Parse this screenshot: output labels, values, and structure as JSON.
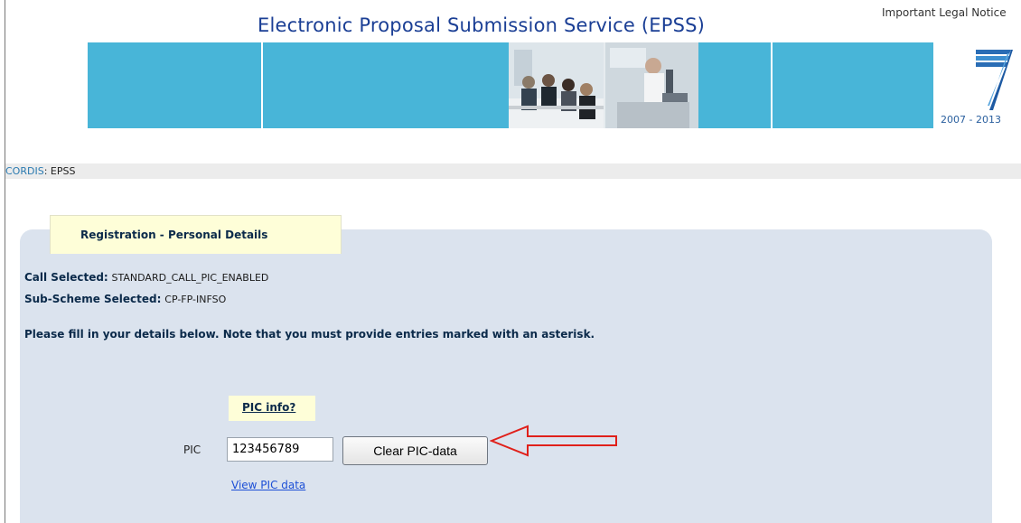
{
  "header": {
    "title": "Electronic Proposal Submission Service  (EPSS)",
    "legal_notice": "Important Legal Notice",
    "logo_years": "2007 - 2013"
  },
  "breadcrumb": {
    "root": "CORDIS",
    "separator": ":",
    "current": "EPSS"
  },
  "panel": {
    "tab_title": "Registration - Personal Details",
    "call_label": "Call Selected:",
    "call_value": "STANDARD_CALL_PIC_ENABLED",
    "subscheme_label": "Sub-Scheme Selected:",
    "subscheme_value": "CP-FP-INFSO",
    "instructions": "Please fill in your details below. Note that you must provide entries marked with an asterisk."
  },
  "pic": {
    "info_link": "PIC info?",
    "label": "PIC",
    "value": "123456789",
    "clear_button": "Clear PIC-data",
    "view_link": "View PIC data"
  },
  "icons": {
    "banner_photo": "meeting-and-lab-photo",
    "fp7_logo": "fp7-logo-icon",
    "callout": "red-arrow-icon"
  },
  "colors": {
    "title": "#1b3f95",
    "banner": "#48b5d8",
    "panel": "#dbe3ee",
    "tab": "#fefed8",
    "link": "#1c4fd6",
    "arrow": "#e0201a"
  }
}
